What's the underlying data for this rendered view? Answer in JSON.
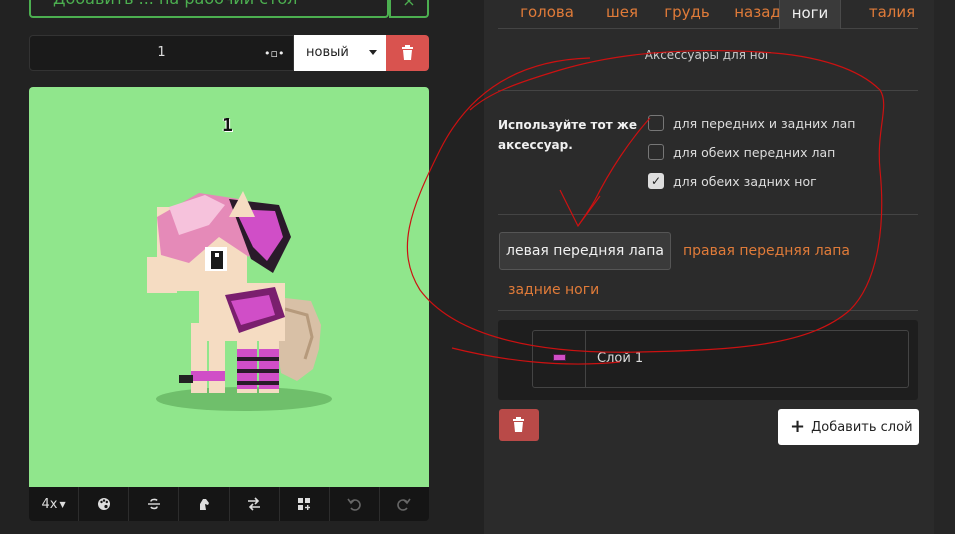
{
  "top_button": {
    "label": "Добавить ... на рабочий стол",
    "close": "×"
  },
  "name_row": {
    "value": "1",
    "select_value": "новый"
  },
  "canvas": {
    "label": "1",
    "bg_color": "#90e68c"
  },
  "toolbar": {
    "zoom": "4x"
  },
  "tabs": [
    {
      "label": "голова"
    },
    {
      "label": "шея"
    },
    {
      "label": "грудь"
    },
    {
      "label": "назад"
    },
    {
      "label": "ноги",
      "active": true
    },
    {
      "label": "талия"
    }
  ],
  "accessories": {
    "title": "Аксессуары для ног",
    "same_label": "Используйте тот же аксессуар.",
    "options": [
      {
        "label": "для передних и задних лап",
        "checked": false
      },
      {
        "label": "для обеих передних лап",
        "checked": false
      },
      {
        "label": "для обеих задних ног",
        "checked": true
      }
    ]
  },
  "legs": {
    "active": "левая передняя лапа",
    "right_front": "правая передняя лапа",
    "back": "задние ноги"
  },
  "layers": [
    {
      "name": "Слой 1",
      "color": "#d04ec7"
    }
  ],
  "add_layer_label": "Добавить слой",
  "colors": {
    "accent": "#e07b39",
    "danger": "#d9534f",
    "green": "#4caf50",
    "annotation": "#cc1111"
  }
}
